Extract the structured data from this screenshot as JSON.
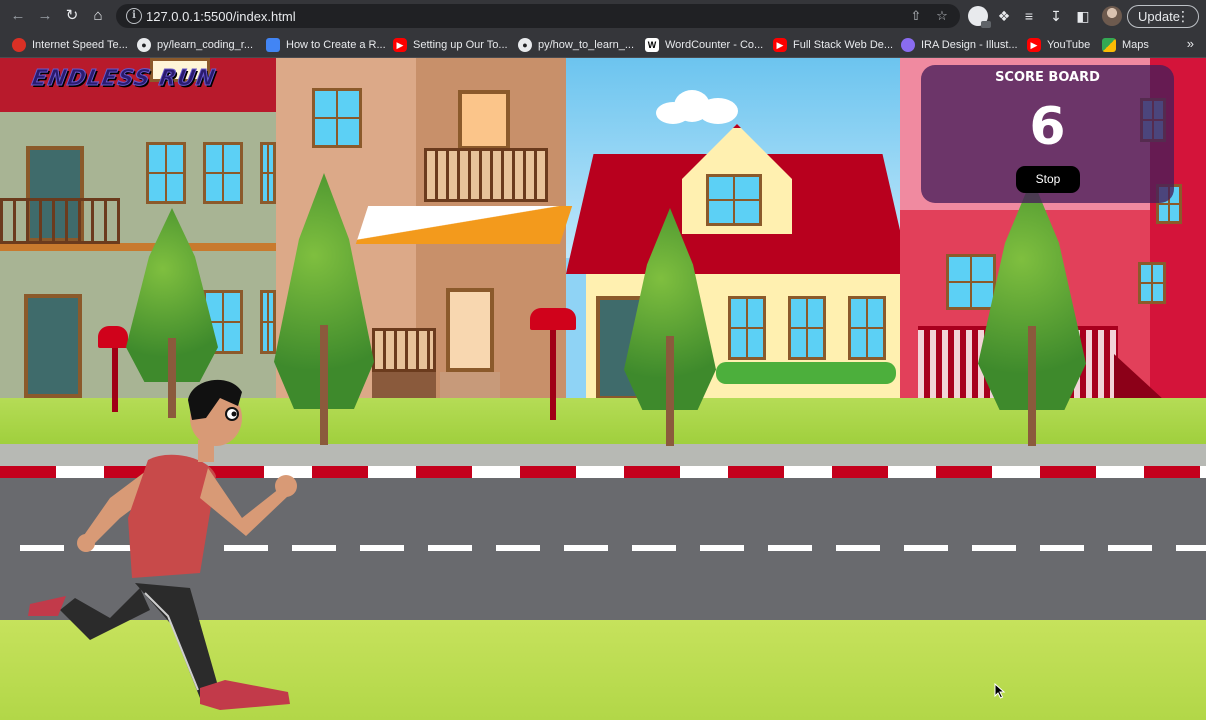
{
  "browser": {
    "url": "127.0.0.1:5500/index.html",
    "update_label": "Update",
    "bookmarks": [
      "Internet Speed Te...",
      "py/learn_coding_r...",
      "How to Create a R...",
      "Setting up Our To...",
      "py/how_to_learn_...",
      "WordCounter - Co...",
      "Full Stack Web De...",
      "IRA Design - Illust...",
      "YouTube",
      "Maps"
    ]
  },
  "game": {
    "logo_text": "ENDLESS RUN",
    "scoreboard": {
      "title": "SCORE BOARD",
      "score": "6",
      "stop_label": "Stop"
    }
  },
  "colors": {
    "road": "#696a6e",
    "curb_red": "#c4001c",
    "grass": "#b2d748",
    "scoreboard_bg": "#461e5a"
  }
}
